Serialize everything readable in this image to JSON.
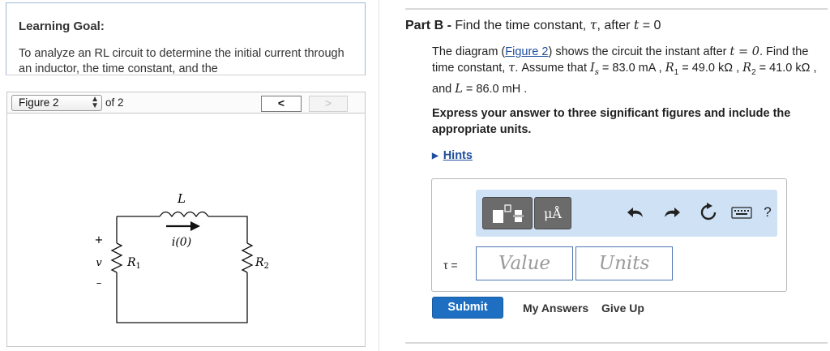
{
  "learning_goal": {
    "title": "Learning Goal:",
    "text": "To analyze an RL circuit to determine the initial current through an inductor, the time constant, and the"
  },
  "figure_toolbar": {
    "selected": "Figure 2",
    "of_label": "of 2",
    "prev_label": "<",
    "next_label": ">"
  },
  "circuit": {
    "inductor_label": "L",
    "current_label": "i(0)",
    "r1_label": "R",
    "r1_sub": "1",
    "r2_label": "R",
    "r2_sub": "2",
    "source_label": "v",
    "plus": "+",
    "minus": "–"
  },
  "part": {
    "prefix": "Part B",
    "sep": " - ",
    "title_text": "Find the time constant, ",
    "tau": "τ",
    "after": ", after ",
    "t": "t",
    "eq_zero": " = 0"
  },
  "problem": {
    "t1": "The diagram (",
    "link": "Figure 2",
    "t2": ") shows the circuit the instant after ",
    "t_eq": "t = 0",
    "t3": ". Find the time constant, ",
    "tau": "τ",
    "t4": ". Assume that ",
    "is": "I",
    "is_sub": "s",
    "t5": " = 83.0 mA , ",
    "r1": "R",
    "r1_sub": "1",
    "t6": " = 49.0 kΩ , ",
    "r2": "R",
    "r2_sub": "2",
    "t7": " = 41.0 kΩ , and ",
    "L": "L",
    "t8": " = 86.0 mH ."
  },
  "express": "Express your answer to three significant figures and include the appropriate units.",
  "hints": {
    "label": "Hints"
  },
  "toolbar": {
    "units_label": "μÅ",
    "undo_icon": "undo-arrow-icon",
    "redo_icon": "redo-arrow-icon",
    "reset_icon": "reset-icon",
    "keyboard_icon": "keyboard-icon",
    "help_label": "?"
  },
  "answer": {
    "tau_label": "τ =",
    "value_placeholder": "Value",
    "units_placeholder": "Units"
  },
  "actions": {
    "submit": "Submit",
    "my_answers": "My Answers",
    "give_up": "Give Up"
  }
}
